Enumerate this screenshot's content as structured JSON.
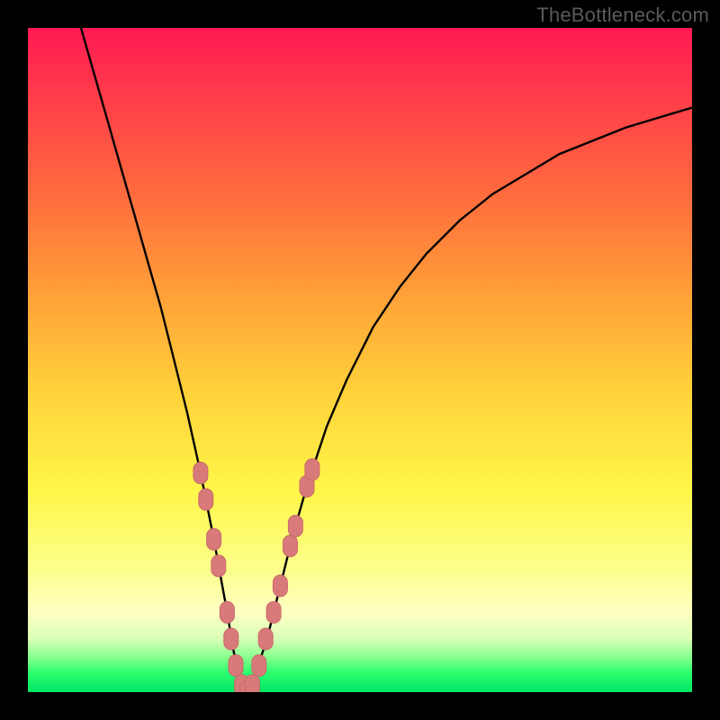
{
  "watermark": "TheBottleneck.com",
  "colors": {
    "frame": "#000000",
    "curve": "#000000",
    "marker_fill": "#d97a7a",
    "marker_stroke": "#c96a6a",
    "gradient_top": "#ff1a52",
    "gradient_bottom": "#00e566"
  },
  "chart_data": {
    "type": "line",
    "title": "",
    "xlabel": "",
    "ylabel": "",
    "xlim": [
      0,
      100
    ],
    "ylim": [
      0,
      100
    ],
    "grid": false,
    "legend": false,
    "series": [
      {
        "name": "bottleneck-curve",
        "x": [
          8,
          10,
          12,
          14,
          16,
          18,
          20,
          22,
          24,
          26,
          28,
          30,
          31,
          32,
          33,
          34,
          36,
          38,
          40,
          42,
          45,
          48,
          52,
          56,
          60,
          65,
          70,
          75,
          80,
          85,
          90,
          95,
          100
        ],
        "y": [
          100,
          93,
          86,
          79,
          72,
          65,
          58,
          50,
          42,
          33,
          23,
          12,
          6,
          2,
          0,
          2,
          8,
          16,
          24,
          31,
          40,
          47,
          55,
          61,
          66,
          71,
          75,
          78,
          81,
          83,
          85,
          86.5,
          88
        ]
      }
    ],
    "markers": {
      "name": "highlight-dots",
      "points": [
        {
          "x": 26.0,
          "y": 33
        },
        {
          "x": 26.8,
          "y": 29
        },
        {
          "x": 28.0,
          "y": 23
        },
        {
          "x": 28.7,
          "y": 19
        },
        {
          "x": 30.0,
          "y": 12
        },
        {
          "x": 30.6,
          "y": 8
        },
        {
          "x": 31.3,
          "y": 4
        },
        {
          "x": 32.2,
          "y": 1
        },
        {
          "x": 33.0,
          "y": 0
        },
        {
          "x": 33.8,
          "y": 1
        },
        {
          "x": 34.8,
          "y": 4
        },
        {
          "x": 35.8,
          "y": 8
        },
        {
          "x": 37.0,
          "y": 12
        },
        {
          "x": 38.0,
          "y": 16
        },
        {
          "x": 39.5,
          "y": 22
        },
        {
          "x": 40.3,
          "y": 25
        },
        {
          "x": 42.0,
          "y": 31
        },
        {
          "x": 42.8,
          "y": 33.5
        }
      ]
    }
  }
}
